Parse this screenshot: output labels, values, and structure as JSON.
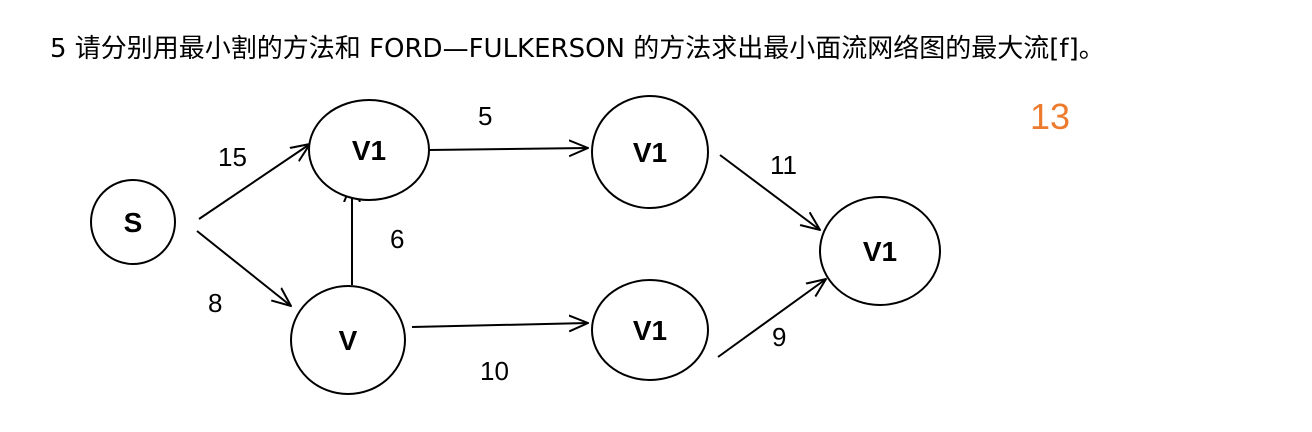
{
  "question": "5 请分别用最小割的方法和 FORD—FULKERSON 的方法求出最小面流网络图的最大流[f]。",
  "answer": "13",
  "answer_color": "#ec7b2e",
  "nodes": [
    {
      "id": "s",
      "label": "S"
    },
    {
      "id": "a",
      "label": "V1"
    },
    {
      "id": "b",
      "label": "V1"
    },
    {
      "id": "v",
      "label": "V"
    },
    {
      "id": "c",
      "label": "V1"
    },
    {
      "id": "t",
      "label": "V1"
    }
  ],
  "edges": [
    {
      "from": "s",
      "to": "a",
      "capacity": "15"
    },
    {
      "from": "s",
      "to": "v",
      "capacity": "8"
    },
    {
      "from": "v",
      "to": "a",
      "capacity": "6"
    },
    {
      "from": "a",
      "to": "b",
      "capacity": "5"
    },
    {
      "from": "v",
      "to": "c",
      "capacity": "10"
    },
    {
      "from": "b",
      "to": "t",
      "capacity": "11"
    },
    {
      "from": "c",
      "to": "t",
      "capacity": "9"
    }
  ]
}
